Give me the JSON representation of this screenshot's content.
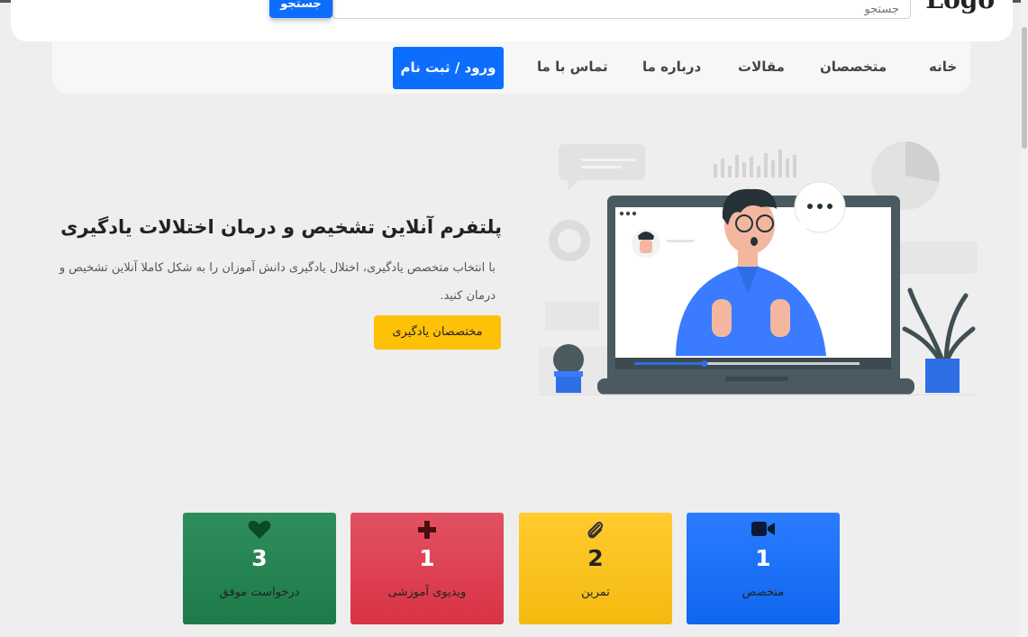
{
  "header": {
    "logo_text": "Logo",
    "search_placeholder": "جستجو",
    "search_button": "جستجو"
  },
  "nav": {
    "items": [
      "خانه",
      "متخصصان",
      "مقالات",
      "درباره ما",
      "تماس با ما"
    ],
    "login_label": "ورود / ثبت نام"
  },
  "hero": {
    "title": "پلتفرم آنلاین تشخیص و درمان اختلالات یادگیری",
    "description": "با انتخاب متخصص یادگیری، اختلال یادگیری دانش آموزان را به شکل کاملا آنلاین تشخیص و درمان کنید.",
    "button_label": "مختصصان یادگیری"
  },
  "stats": [
    {
      "icon": "heart-icon",
      "value": "3",
      "label": "درخواست موفق",
      "color": "#2e8e5a"
    },
    {
      "icon": "plus-icon",
      "value": "1",
      "label": "ویدیوی آموزشی",
      "color": "#dc3545"
    },
    {
      "icon": "paperclip-icon",
      "value": "2",
      "label": "تمرین",
      "color": "#ffc107"
    },
    {
      "icon": "video-camera-icon",
      "value": "1",
      "label": "متخصص",
      "color": "#0d6efd"
    }
  ],
  "colors": {
    "primary": "#0d6efd",
    "warning": "#ffc107",
    "danger": "#dc3545",
    "success": "#198754",
    "background": "#eeeeee"
  }
}
